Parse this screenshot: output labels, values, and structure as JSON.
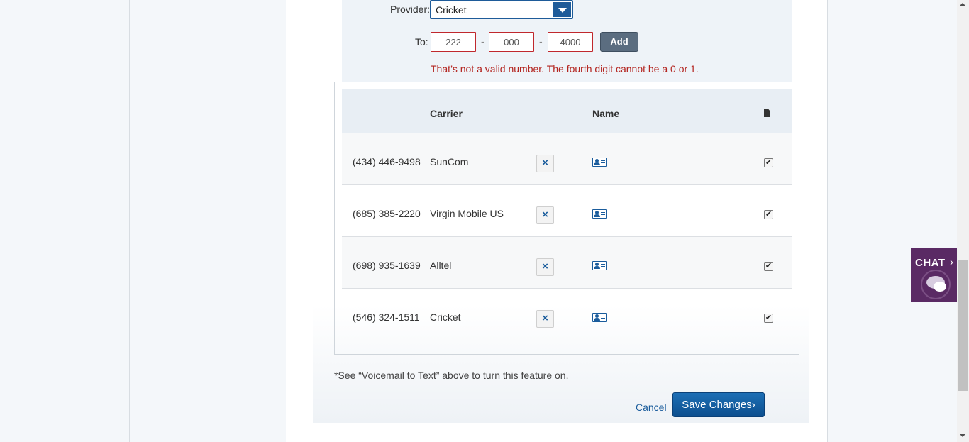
{
  "form": {
    "provider_label": "Provider:",
    "provider_value": "Cricket",
    "to_label": "To:",
    "phone_part1": "222",
    "phone_part2": "000",
    "phone_part3": "4000",
    "separator": "-",
    "add_label": "Add",
    "error": "That’s not a valid number. The fourth digit cannot be a 0 or 1."
  },
  "table": {
    "headers": {
      "carrier": "Carrier",
      "name": "Name"
    },
    "rows": [
      {
        "phone": "(434) 446-9498",
        "carrier": "SunCom",
        "checked": true
      },
      {
        "phone": "(685) 385-2220",
        "carrier": "Virgin Mobile US",
        "checked": true
      },
      {
        "phone": "(698) 935-1639",
        "carrier": "Alltel",
        "checked": true
      },
      {
        "phone": "(546) 324-1511",
        "carrier": "Cricket",
        "checked": true
      }
    ],
    "delete_glyph": "×",
    "check_glyph": "✔"
  },
  "footnote": "*See “Voicemail to Text” above to turn this feature on.",
  "actions": {
    "cancel": "Cancel",
    "save": "Save Changes",
    "save_chevron": "›"
  },
  "chat": {
    "label": "CHAT",
    "chevron": "›"
  },
  "colors": {
    "primary": "#1e5b99",
    "error": "#b3241f",
    "chat_bg": "#5a2a64",
    "add_button": "#5b6d80"
  },
  "icons": {
    "dropdown": "chevron-down-icon",
    "delete": "close-icon",
    "contact": "contact-card-icon",
    "document": "document-icon",
    "chat": "chat-bubble-icon"
  }
}
